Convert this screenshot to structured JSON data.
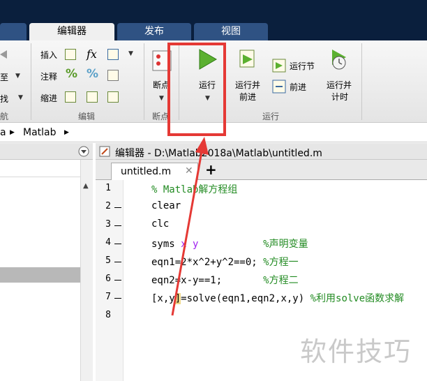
{
  "tabs": [
    {
      "label": "编辑器",
      "active": true
    },
    {
      "label": "发布",
      "active": false
    },
    {
      "label": "视图",
      "active": false
    }
  ],
  "ribbon": {
    "left_partial": {
      "label1": "至",
      "label2": "找",
      "section": "航"
    },
    "edit_group": {
      "insert": "插入",
      "comment": "注释",
      "indent": "缩进",
      "section": "编辑"
    },
    "breakpoints": {
      "label": "断点",
      "section": "断点"
    },
    "run_group": {
      "run": "运行",
      "run_advance_line1": "运行并",
      "run_advance_line2": "前进",
      "run_section": "运行节",
      "advance": "前进",
      "run_time_line1": "运行并",
      "run_time_line2": "计时",
      "section": "运行"
    },
    "fx_label": "fx"
  },
  "breadcrumb": {
    "items": [
      "a",
      "Matlab"
    ]
  },
  "editor": {
    "title": "编辑器 - D:\\Matlab2018a\\Matlab\\untitled.m",
    "file_tab": "untitled.m",
    "lines": [
      {
        "n": "1",
        "dash": false,
        "parts": [
          {
            "t": "% Matlab解方程组",
            "c": "cmt"
          }
        ]
      },
      {
        "n": "2",
        "dash": true,
        "parts": [
          {
            "t": "clear",
            "c": ""
          }
        ]
      },
      {
        "n": "3",
        "dash": true,
        "parts": [
          {
            "t": "clc",
            "c": ""
          }
        ]
      },
      {
        "n": "4",
        "dash": true,
        "parts": [
          {
            "t": "syms ",
            "c": ""
          },
          {
            "t": "x y",
            "c": "var"
          },
          {
            "t": "           ",
            "c": ""
          },
          {
            "t": "%声明变量",
            "c": "cmt"
          }
        ]
      },
      {
        "n": "5",
        "dash": true,
        "parts": [
          {
            "t": "eqn1=2*x^2+y^2==0; ",
            "c": ""
          },
          {
            "t": "%方程一",
            "c": "cmt"
          }
        ]
      },
      {
        "n": "6",
        "dash": true,
        "parts": [
          {
            "t": "eqn2=x-y==1;       ",
            "c": ""
          },
          {
            "t": "%方程二",
            "c": "cmt"
          }
        ]
      },
      {
        "n": "7",
        "dash": true,
        "parts": [
          {
            "t": "[x,y",
            "c": ""
          },
          {
            "t": "]",
            "c": "hl"
          },
          {
            "t": "=solve(eqn1,eqn2,x,y) ",
            "c": ""
          },
          {
            "t": "%利用solve函数求解",
            "c": "cmt"
          }
        ]
      },
      {
        "n": "8",
        "dash": false,
        "parts": []
      }
    ]
  },
  "watermark": "软件技巧",
  "colors": {
    "titlebar": "#0a1f3d",
    "inactive_tab": "#2f5283",
    "highlight_box": "#e53935",
    "comment": "#228b22",
    "variable": "#a020f0",
    "run_icon": "#5bb030"
  }
}
